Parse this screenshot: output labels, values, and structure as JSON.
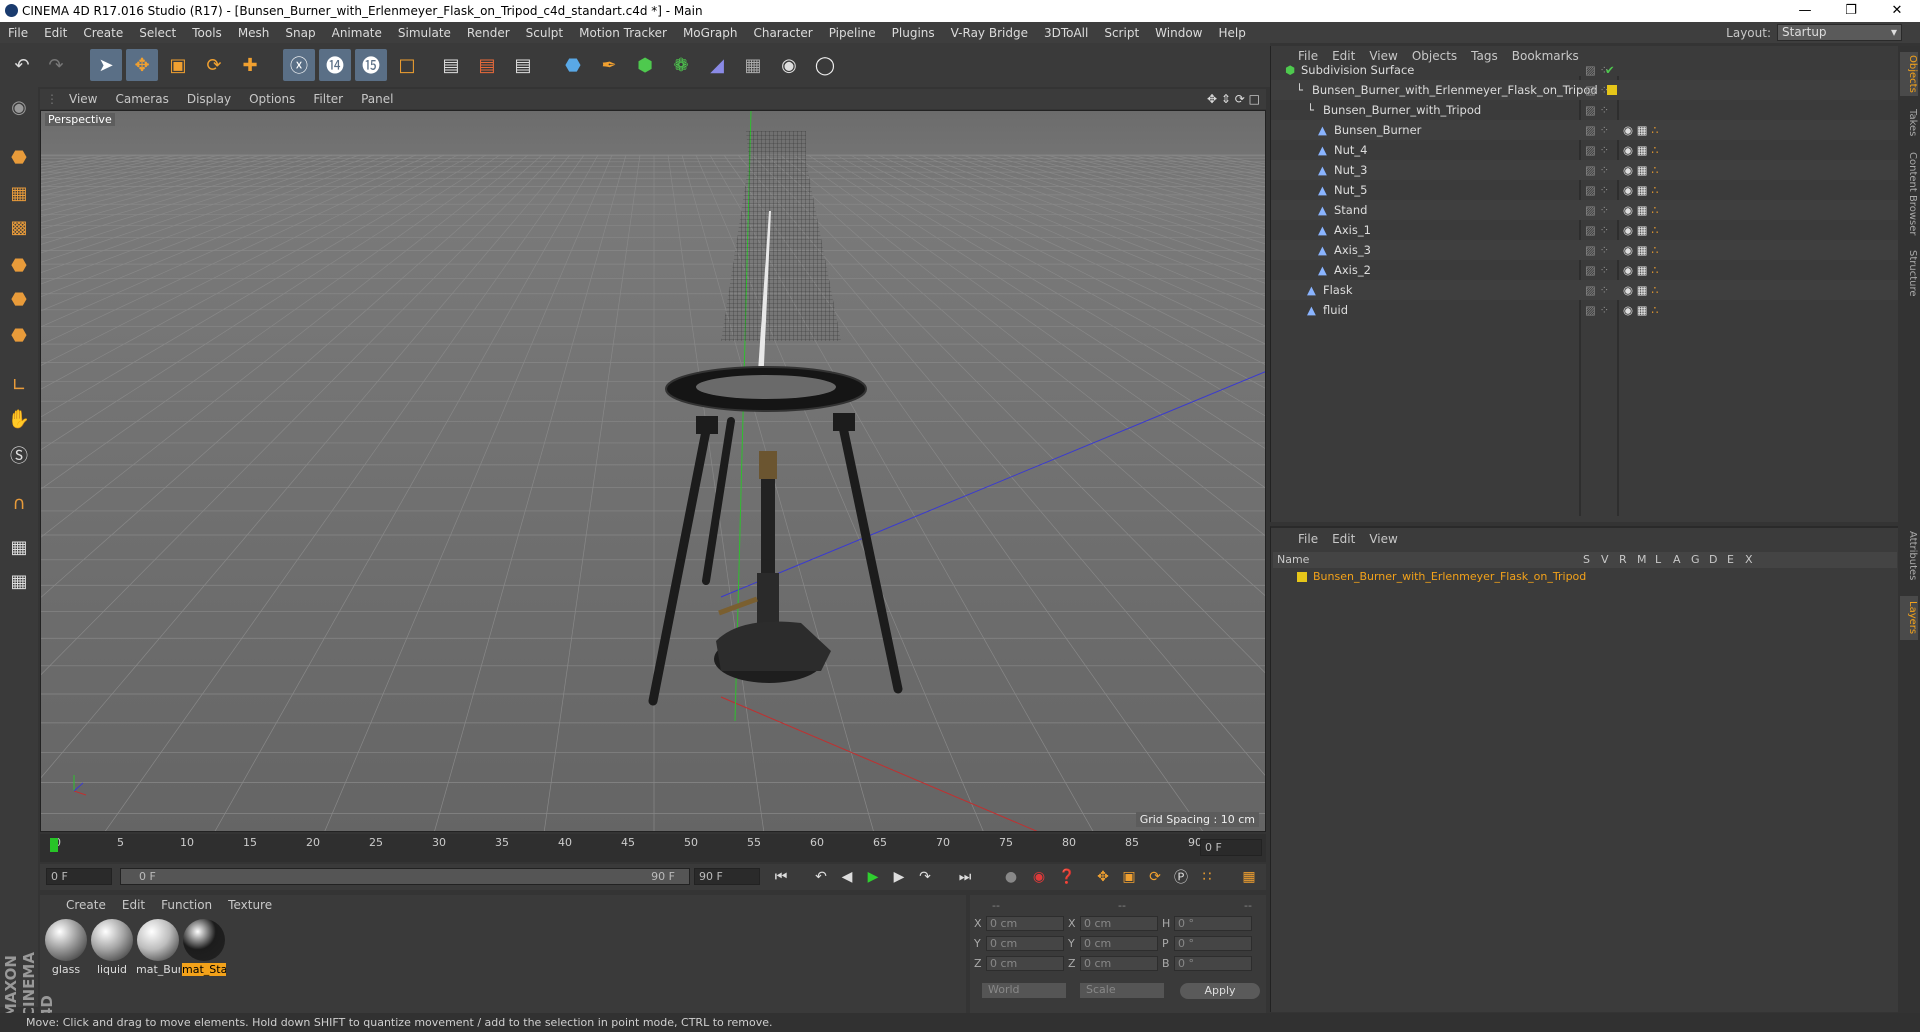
{
  "window": {
    "title": "CINEMA 4D R17.016 Studio (R17) - [Bunsen_Burner_with_Erlenmeyer_Flask_on_Tripod_c4d_standart.c4d *] - Main"
  },
  "menu": [
    "File",
    "Edit",
    "Create",
    "Select",
    "Tools",
    "Mesh",
    "Snap",
    "Animate",
    "Simulate",
    "Render",
    "Sculpt",
    "Motion Tracker",
    "MoGraph",
    "Character",
    "Pipeline",
    "Plugins",
    "V-Ray Bridge",
    "3DToAll",
    "Script",
    "Window",
    "Help"
  ],
  "layout": {
    "label": "Layout:",
    "value": "Startup"
  },
  "viewport": {
    "menu": [
      "View",
      "Cameras",
      "Display",
      "Options",
      "Filter",
      "Panel"
    ],
    "label": "Perspective",
    "grid_spacing": "Grid Spacing : 10 cm"
  },
  "timeline": {
    "ticks": [
      "0",
      "5",
      "10",
      "15",
      "20",
      "25",
      "30",
      "35",
      "40",
      "45",
      "50",
      "55",
      "60",
      "65",
      "70",
      "75",
      "80",
      "85",
      "90"
    ],
    "end_field": "0 F",
    "start": "0 F",
    "range_start": "0 F",
    "range_end": "90 F",
    "end": "90 F"
  },
  "materials": {
    "menu": [
      "Create",
      "Edit",
      "Function",
      "Texture"
    ],
    "items": [
      {
        "name": "glass",
        "color": "#9a9a9a"
      },
      {
        "name": "liquid",
        "color": "#a5a5a5"
      },
      {
        "name": "mat_Bur",
        "color": "#bdbdbd"
      },
      {
        "name": "mat_Sta",
        "color": "#1c1c1c"
      }
    ]
  },
  "coords": {
    "headers": [
      "--",
      "--",
      "--"
    ],
    "rows": [
      {
        "a": "X",
        "v1": "0 cm",
        "b": "X",
        "v2": "0 cm",
        "c": "H",
        "v3": "0 °"
      },
      {
        "a": "Y",
        "v1": "0 cm",
        "b": "Y",
        "v2": "0 cm",
        "c": "P",
        "v3": "0 °"
      },
      {
        "a": "Z",
        "v1": "0 cm",
        "b": "Z",
        "v2": "0 cm",
        "c": "B",
        "v3": "0 °"
      }
    ],
    "world": "World",
    "scale": "Scale",
    "apply": "Apply"
  },
  "status": "Move: Click and drag to move elements. Hold down SHIFT to quantize movement / add to the selection in point mode, CTRL to remove.",
  "objects": {
    "menu": [
      "File",
      "Edit",
      "View",
      "Objects",
      "Tags",
      "Bookmarks"
    ],
    "rows": [
      {
        "name": "Subdivision Surface",
        "indent": 0
      },
      {
        "name": "Bunsen_Burner_with_Erlenmeyer_Flask_on_Tripod",
        "indent": 1
      },
      {
        "name": "Bunsen_Burner_with_Tripod",
        "indent": 2
      },
      {
        "name": "Bunsen_Burner",
        "indent": 3
      },
      {
        "name": "Nut_4",
        "indent": 3
      },
      {
        "name": "Nut_3",
        "indent": 3
      },
      {
        "name": "Nut_5",
        "indent": 3
      },
      {
        "name": "Stand",
        "indent": 3
      },
      {
        "name": "Axis_1",
        "indent": 3
      },
      {
        "name": "Axis_3",
        "indent": 3
      },
      {
        "name": "Axis_2",
        "indent": 3
      },
      {
        "name": "Flask",
        "indent": 2
      },
      {
        "name": "fluid",
        "indent": 2
      }
    ]
  },
  "layers": {
    "menu": [
      "File",
      "Edit",
      "View"
    ],
    "header": {
      "name": "Name",
      "cols": [
        "S",
        "V",
        "R",
        "M",
        "L",
        "A",
        "G",
        "D",
        "E",
        "X"
      ]
    },
    "rows": [
      {
        "name": "Bunsen_Burner_with_Erlenmeyer_Flask_on_Tripod",
        "color": "#e6c619"
      }
    ]
  },
  "side_tabs": [
    "Objects",
    "Takes",
    "Content Browser",
    "Structure",
    "Attributes",
    "Layers"
  ],
  "logo": "MAXON CINEMA 4D"
}
